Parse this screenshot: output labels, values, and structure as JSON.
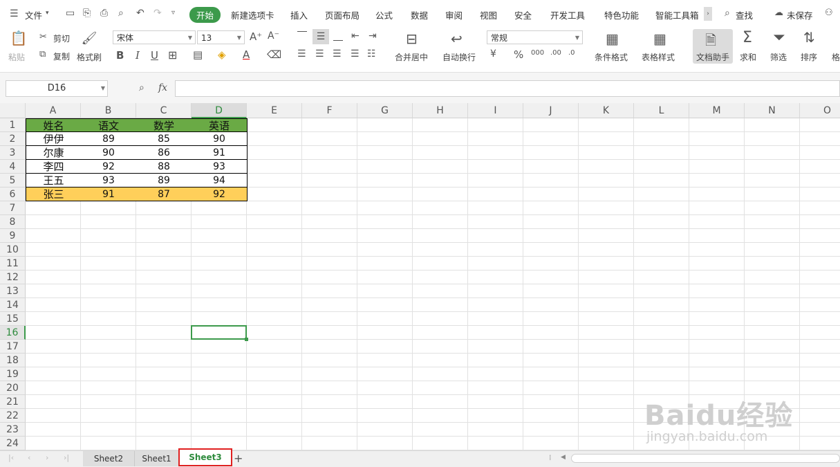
{
  "menu": {
    "file": "文件",
    "tabs": [
      "开始",
      "新建选项卡",
      "插入",
      "页面布局",
      "公式",
      "数据",
      "审阅",
      "视图",
      "安全",
      "开发工具",
      "特色功能",
      "智能工具箱"
    ],
    "search": "查找",
    "unsaved": "未保存"
  },
  "ribbon": {
    "paste": "粘贴",
    "cut": "剪切",
    "copy": "复制",
    "format_painter": "格式刷",
    "font_name": "宋体",
    "font_size": "13",
    "merge_center": "合并居中",
    "wrap_text": "自动换行",
    "number_format": "常规",
    "conditional_format": "条件格式",
    "table_style": "表格样式",
    "doc_helper": "文档助手",
    "sum": "求和",
    "filter": "筛选",
    "sort": "排序",
    "format": "格"
  },
  "formula_bar": {
    "name_box": "D16",
    "fx": "fx",
    "value": ""
  },
  "grid": {
    "columns": [
      "A",
      "B",
      "C",
      "D",
      "E",
      "F",
      "G",
      "H",
      "I",
      "J",
      "K",
      "L",
      "M",
      "N",
      "O"
    ],
    "rows": [
      "1",
      "2",
      "3",
      "4",
      "5",
      "6",
      "7",
      "8",
      "9",
      "10",
      "11",
      "12",
      "13",
      "14",
      "15",
      "16",
      "17",
      "18",
      "19",
      "20",
      "21",
      "22",
      "23",
      "24"
    ],
    "selected_cell": "D16",
    "header_color": "#6aaa45",
    "highlight_color": "#ffcf5a",
    "table": [
      [
        "姓名",
        "语文",
        "数学",
        "英语"
      ],
      [
        "伊伊",
        "89",
        "85",
        "90"
      ],
      [
        "尔康",
        "90",
        "86",
        "91"
      ],
      [
        "李四",
        "92",
        "88",
        "93"
      ],
      [
        "王五",
        "93",
        "89",
        "94"
      ],
      [
        "张三",
        "91",
        "87",
        "92"
      ]
    ]
  },
  "sheets": [
    "Sheet2",
    "Sheet1",
    "Sheet3"
  ],
  "active_sheet": "Sheet3",
  "watermark": {
    "brand": "Baidu经验",
    "url": "jingyan.baidu.com"
  }
}
